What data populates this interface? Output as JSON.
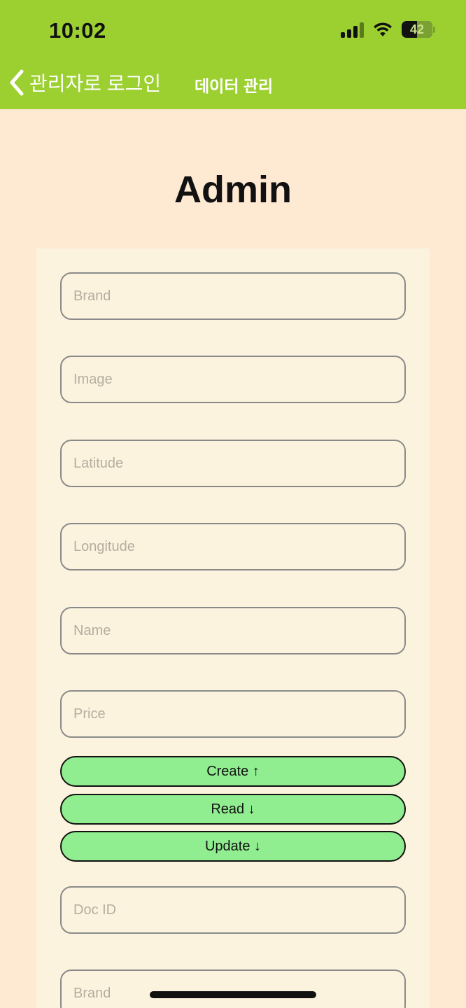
{
  "status_bar": {
    "time": "10:02",
    "battery_level": "42",
    "icons": [
      "signal-icon",
      "wifi-icon",
      "battery-icon"
    ]
  },
  "nav": {
    "back_label": "관리자로 로그인",
    "title": "데이터 관리"
  },
  "page": {
    "title": "Admin"
  },
  "form": {
    "fields": [
      {
        "placeholder": "Brand",
        "value": ""
      },
      {
        "placeholder": "Image",
        "value": ""
      },
      {
        "placeholder": "Latitude",
        "value": ""
      },
      {
        "placeholder": "Longitude",
        "value": ""
      },
      {
        "placeholder": "Name",
        "value": ""
      },
      {
        "placeholder": "Price",
        "value": ""
      }
    ],
    "buttons": [
      {
        "label": "Create ↑"
      },
      {
        "label": "Read ↓"
      },
      {
        "label": "Update ↓"
      }
    ],
    "doc_id": {
      "placeholder": "Doc ID",
      "value": ""
    },
    "brand2": {
      "placeholder": "Brand",
      "value": ""
    }
  },
  "colors": {
    "header": "#9cd031",
    "background": "#fee9d2",
    "card": "#fcf3de",
    "button": "#90ee90"
  }
}
